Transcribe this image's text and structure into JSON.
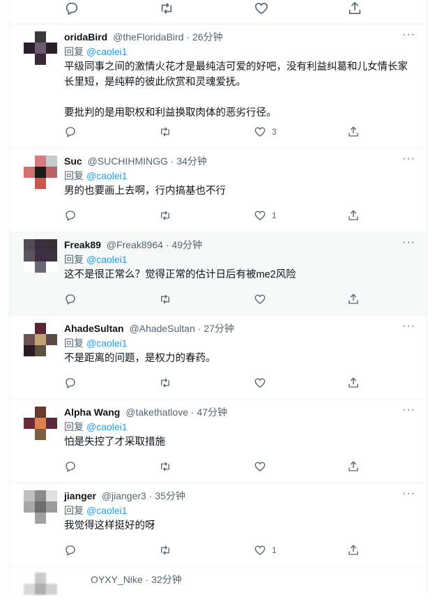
{
  "top_actions": {
    "reply": "",
    "retweet": "",
    "like": "",
    "share": ""
  },
  "tweets": [
    {
      "name": "oridaBird",
      "handle": "@theFloridaBird",
      "time": "26分钟",
      "reply_prefix": "回复",
      "reply_to": "@caolei1",
      "text": "平级同事之间的激情火花才是最纯洁可爱的好吧，没有利益纠葛和儿女情长家长里短，是纯粹的彼此欣赏和灵魂爱抚。\n\n要批判的是用职权和利益换取肉体的恶劣行径。",
      "replies": "",
      "retweets": "",
      "likes": "3"
    },
    {
      "name": "Suc",
      "handle": "@SUCHIHMINGG",
      "time": "34分钟",
      "reply_prefix": "回复",
      "reply_to": "@caolei1",
      "text": "男的也要画上去啊，行内搞基也不行",
      "replies": "",
      "retweets": "",
      "likes": "1"
    },
    {
      "name": "Freak89",
      "handle": "@Freak8964",
      "time": "49分钟",
      "reply_prefix": "回复",
      "reply_to": "@caolei1",
      "text": "这不是很正常么？觉得正常的估计日后有被me2风险",
      "replies": "",
      "retweets": "",
      "likes": ""
    },
    {
      "name": "AhadeSultan",
      "handle": "@AhadeSultan",
      "time": "27分钟",
      "reply_prefix": "回复",
      "reply_to": "@caolei1",
      "text": "不是距离的问题，是权力的春药。",
      "replies": "",
      "retweets": "",
      "likes": ""
    },
    {
      "name": "Alpha Wang",
      "handle": "@takethatlove",
      "time": "47分钟",
      "reply_prefix": "回复",
      "reply_to": "@caolei1",
      "text": "怕是失控了才采取措施",
      "replies": "",
      "retweets": "",
      "likes": ""
    },
    {
      "name": "jianger",
      "handle": "@jianger3",
      "time": "35分钟",
      "reply_prefix": "回复",
      "reply_to": "@caolei1",
      "text": "我觉得这样挺好的呀",
      "replies": "",
      "retweets": "",
      "likes": "1"
    }
  ],
  "cut_tweet": {
    "handle": "OYXY_Nike",
    "time": "32分钟"
  },
  "avatar_colors": [
    [
      "#ffffff",
      "#3a3a3a",
      "#ffffff",
      "#2b1d2a",
      "#6a5b70",
      "#2a1f2b",
      "#ffffff",
      "#3b2a35",
      "#ffffff"
    ],
    [
      "#ffffff",
      "#d57a7e",
      "#c9c9c9",
      "#d0726f",
      "#1d1a1a",
      "#b6646a",
      "#ffffff",
      "#c6584e",
      "#ffffff"
    ],
    [
      "#4f4a55",
      "#3b2d40",
      "#3a2f37",
      "#5a5560",
      "#3d2f45",
      "#3c3340",
      "#ffffff",
      "#6a6677",
      "#ffffff"
    ],
    [
      "#ffffff",
      "#5a2535",
      "#ffffff",
      "#6e5157",
      "#c0a274",
      "#5b4a45",
      "#2b1b22",
      "#5a5140",
      "#ffffff"
    ],
    [
      "#ffffff",
      "#6a3b2b",
      "#ffffff",
      "#6d2a36",
      "#e0804f",
      "#5b2a3a",
      "#ffffff",
      "#7a6040",
      "#ffffff"
    ],
    [
      "#bfbfbf",
      "#8a8a8a",
      "#e0e0e0",
      "#a8a8a8",
      "#6d6d6d",
      "#9b9b9b",
      "#ffffff",
      "#a0a0a0",
      "#ffffff"
    ],
    [
      "#ffffff",
      "#bdbdbd",
      "#ffffff",
      "#d0d0d0",
      "#9a9a9a",
      "#c8c8c8",
      "#ffffff",
      "#ffffff",
      "#ffffff"
    ]
  ]
}
